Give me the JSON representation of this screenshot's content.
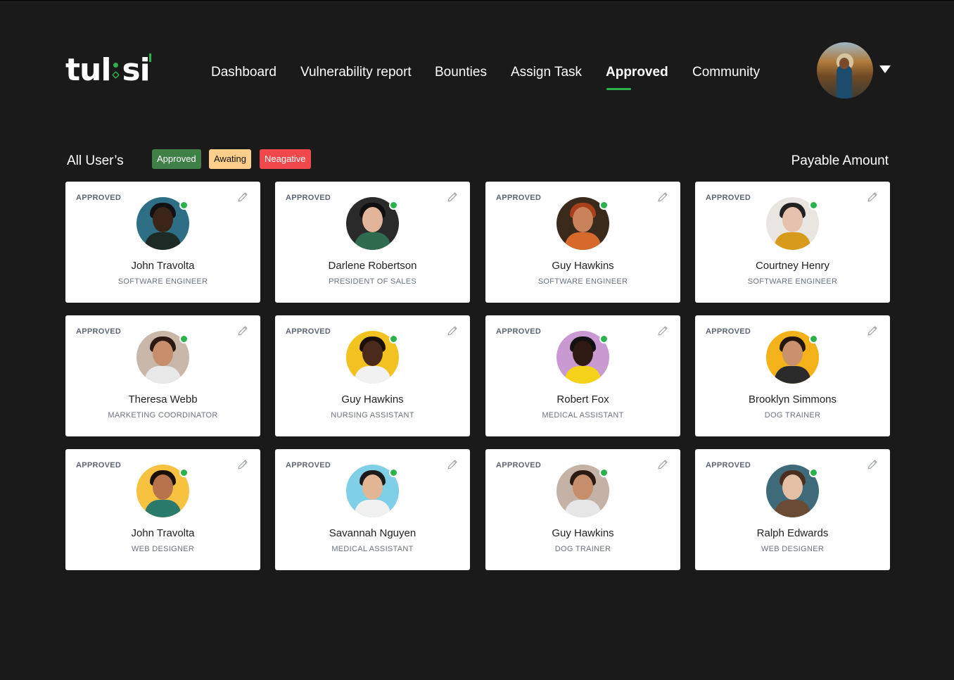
{
  "app": {
    "logo_text_left": "tul",
    "logo_text_right": "si"
  },
  "nav": {
    "items": [
      {
        "label": "Dashboard",
        "active": false
      },
      {
        "label": "Vulnerability report",
        "active": false
      },
      {
        "label": "Bounties",
        "active": false
      },
      {
        "label": "Assign Task",
        "active": false
      },
      {
        "label": "Approved",
        "active": true
      },
      {
        "label": "Community",
        "active": false
      }
    ]
  },
  "filters": {
    "title": "All User’s",
    "approved": "Approved",
    "awaiting": "Awating",
    "negative": "Neagative",
    "payable_label": "Payable Amount"
  },
  "colors": {
    "accent": "#2bb24c",
    "approved_pill": "#3e8046",
    "awaiting_pill": "#ffce8a",
    "negative_pill": "#f1484c",
    "background": "#1a1a1a"
  },
  "cards": [
    {
      "status": "APPROVED",
      "name": "John Travolta",
      "role": "SOFTWARE ENGINEER",
      "photo_bg": "#2e6f86",
      "skin": "#3b2418",
      "hair": "#111111",
      "shirt": "#1d2a25"
    },
    {
      "status": "APPROVED",
      "name": "Darlene Robertson",
      "role": "PRESIDENT OF SALES",
      "photo_bg": "#2a2a2a",
      "skin": "#e1b59a",
      "hair": "#0f0f0f",
      "shirt": "#2f6b4f"
    },
    {
      "status": "APPROVED",
      "name": "Guy Hawkins",
      "role": "SOFTWARE ENGINEER",
      "photo_bg": "#3a2a1c",
      "skin": "#c9825a",
      "hair": "#a8401e",
      "shirt": "#d76a2a"
    },
    {
      "status": "APPROVED",
      "name": "Courtney Henry",
      "role": "SOFTWARE ENGINEER",
      "photo_bg": "#e9e6e2",
      "skin": "#e4c2ad",
      "hair": "#222222",
      "shirt": "#d89a1a"
    },
    {
      "status": "APPROVED",
      "name": "Theresa Webb",
      "role": "MARKETING COORDINATOR",
      "photo_bg": "#c9b7aa",
      "skin": "#c68e6a",
      "hair": "#2b1a12",
      "shirt": "#e8e8e8"
    },
    {
      "status": "APPROVED",
      "name": "Guy Hawkins",
      "role": "NURSING ASSISTANT",
      "photo_bg": "#f2c320",
      "skin": "#4a2a1a",
      "hair": "#1a100a",
      "shirt": "#f1f1f1"
    },
    {
      "status": "APPROVED",
      "name": "Robert Fox",
      "role": "MEDICAL ASSISTANT",
      "photo_bg": "#c99ad1",
      "skin": "#2e1a12",
      "hair": "#111111",
      "shirt": "#f4d21a"
    },
    {
      "status": "APPROVED",
      "name": "Brooklyn Simmons",
      "role": "DOG TRAINER",
      "photo_bg": "#f4b21a",
      "skin": "#c9926c",
      "hair": "#24160e",
      "shirt": "#2b2b2b"
    },
    {
      "status": "APPROVED",
      "name": "John Travolta",
      "role": "WEB DESIGNER",
      "photo_bg": "#f7c23f",
      "skin": "#b9734c",
      "hair": "#1a100a",
      "shirt": "#2a7b6b"
    },
    {
      "status": "APPROVED",
      "name": "Savannah Nguyen",
      "role": "MEDICAL ASSISTANT",
      "photo_bg": "#7fd0e6",
      "skin": "#e2b595",
      "hair": "#1b1b1b",
      "shirt": "#f0f0f0"
    },
    {
      "status": "APPROVED",
      "name": "Guy Hawkins",
      "role": "DOG TRAINER",
      "photo_bg": "#c4b2a6",
      "skin": "#c68e6a",
      "hair": "#2b1a12",
      "shirt": "#e6e6e6"
    },
    {
      "status": "APPROVED",
      "name": "Ralph Edwards",
      "role": "WEB DESIGNER",
      "photo_bg": "#3f6a79",
      "skin": "#e4bfa6",
      "hair": "#4a2f20",
      "shirt": "#6a4b35"
    }
  ]
}
